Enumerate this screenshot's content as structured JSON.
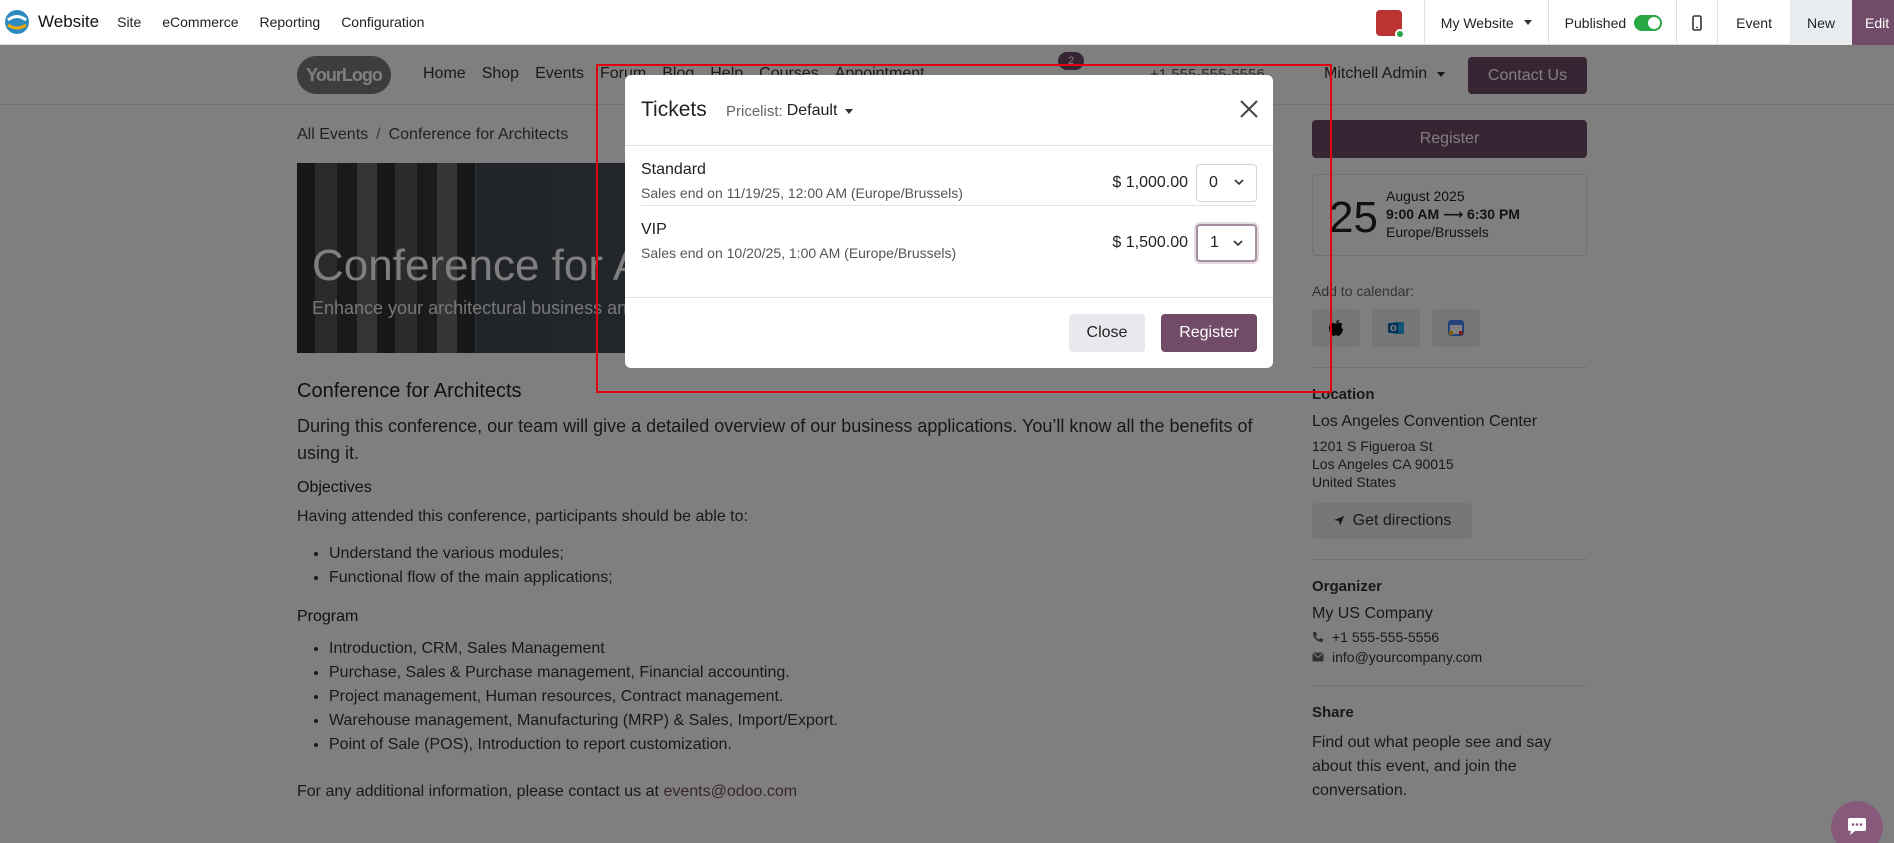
{
  "topbar": {
    "app_name": "Website",
    "menus": [
      "Site",
      "eCommerce",
      "Reporting",
      "Configuration"
    ],
    "website_selector": "My Website",
    "published_label": "Published",
    "event_label": "Event",
    "new_label": "New",
    "edit_label": "Edit"
  },
  "site_header": {
    "logo_text": "YourLogo",
    "nav": [
      "Home",
      "Shop",
      "Events",
      "Forum",
      "Blog",
      "Help",
      "Courses",
      "Appointment"
    ],
    "cart_count": "2",
    "phone": "+1 555-555-5556",
    "user": "Mitchell Admin",
    "contact_button": "Contact Us"
  },
  "breadcrumb": {
    "root": "All Events",
    "current": "Conference for Architects"
  },
  "hero": {
    "title": "Conference for Architects",
    "subtitle": "Enhance your architectural business and improve professional skills"
  },
  "content": {
    "heading": "Conference for Architects",
    "lead": "During this conference, our team will give a detailed overview of our business applications. You’ll know all the benefits of using it.",
    "objectives_heading": "Objectives",
    "objectives_intro": "Having attended this conference, participants should be able to:",
    "objectives": [
      "Understand the various modules;",
      "Functional flow of the main applications;"
    ],
    "program_heading": "Program",
    "program": [
      "Introduction, CRM, Sales Management",
      "Purchase, Sales & Purchase management, Financial accounting.",
      "Project management, Human resources, Contract management.",
      "Warehouse management, Manufacturing (MRP) & Sales, Import/Export.",
      "Point of Sale (POS), Introduction to report customization."
    ],
    "contact_prefix": "For any additional information, please contact us at",
    "contact_email": "events@odoo.com"
  },
  "sidebar": {
    "register_label": "Register",
    "day": "25",
    "month_year": "August 2025",
    "time_start": "9:00 AM",
    "time_end": "6:30 PM",
    "timezone": "Europe/Brussels",
    "add_to_calendar": "Add to calendar:",
    "location_heading": "Location",
    "venue": "Los Angeles Convention Center",
    "address_line1": "1201 S Figueroa St",
    "address_line2": "Los Angeles CA 90015",
    "address_line3": "United States",
    "directions_label": "Get directions",
    "organizer_heading": "Organizer",
    "organizer_name": "My US Company",
    "organizer_phone": "+1 555-555-5556",
    "organizer_email": "info@yourcompany.com",
    "share_heading": "Share",
    "share_text": "Find out what people see and say about this event, and join the conversation."
  },
  "modal": {
    "title": "Tickets",
    "pricelist_label": "Pricelist:",
    "pricelist_value": "Default",
    "tickets": [
      {
        "name": "Standard",
        "sales_end": "Sales end on 11/19/25, 12:00 AM (Europe/Brussels)",
        "price": "$ 1,000.00",
        "qty": "0"
      },
      {
        "name": "VIP",
        "sales_end": "Sales end on 10/20/25, 1:00 AM (Europe/Brussels)",
        "price": "$ 1,500.00",
        "qty": "1"
      }
    ],
    "close_label": "Close",
    "register_label": "Register"
  },
  "colors": {
    "brand": "#714b67",
    "highlight": "#e2000f",
    "published": "#28a745"
  }
}
